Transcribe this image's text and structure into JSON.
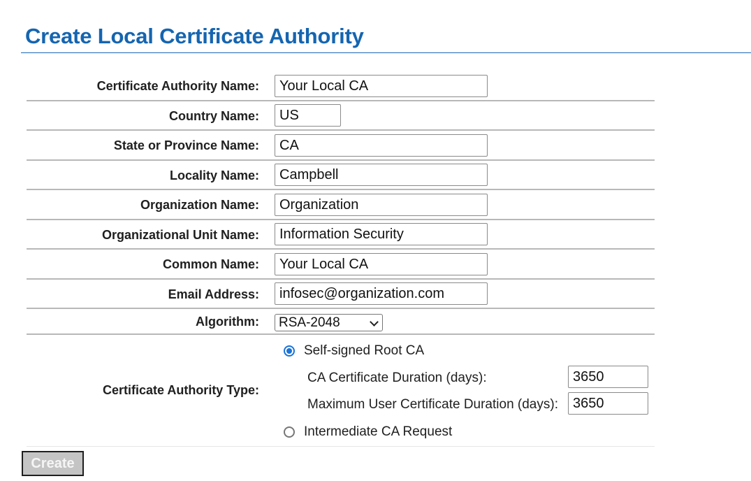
{
  "page": {
    "title": "Create Local Certificate Authority"
  },
  "form": {
    "ca_name": {
      "label": "Certificate Authority Name:",
      "value": "Your Local CA"
    },
    "country": {
      "label": "Country Name:",
      "value": "US"
    },
    "state": {
      "label": "State or Province Name:",
      "value": "CA"
    },
    "locality": {
      "label": "Locality Name:",
      "value": "Campbell"
    },
    "organization": {
      "label": "Organization Name:",
      "value": "Organization"
    },
    "org_unit": {
      "label": "Organizational Unit Name:",
      "value": "Information Security"
    },
    "common_name": {
      "label": "Common Name:",
      "value": "Your Local CA"
    },
    "email": {
      "label": "Email Address:",
      "value": "infosec@organization.com"
    },
    "algorithm": {
      "label": "Algorithm:",
      "value": "RSA-2048"
    },
    "ca_type": {
      "label": "Certificate Authority Type:",
      "self_signed_label": "Self-signed Root CA",
      "self_signed_selected": true,
      "ca_duration_label": "CA Certificate Duration (days):",
      "ca_duration_value": "3650",
      "max_user_duration_label": "Maximum User Certificate Duration (days):",
      "max_user_duration_value": "3650",
      "intermediate_label": "Intermediate CA Request",
      "intermediate_selected": false
    }
  },
  "actions": {
    "create_label": "Create"
  },
  "colors": {
    "title": "#1565b0",
    "radio_accent": "#1a73d9",
    "button_disabled": "#c4c4c4"
  }
}
